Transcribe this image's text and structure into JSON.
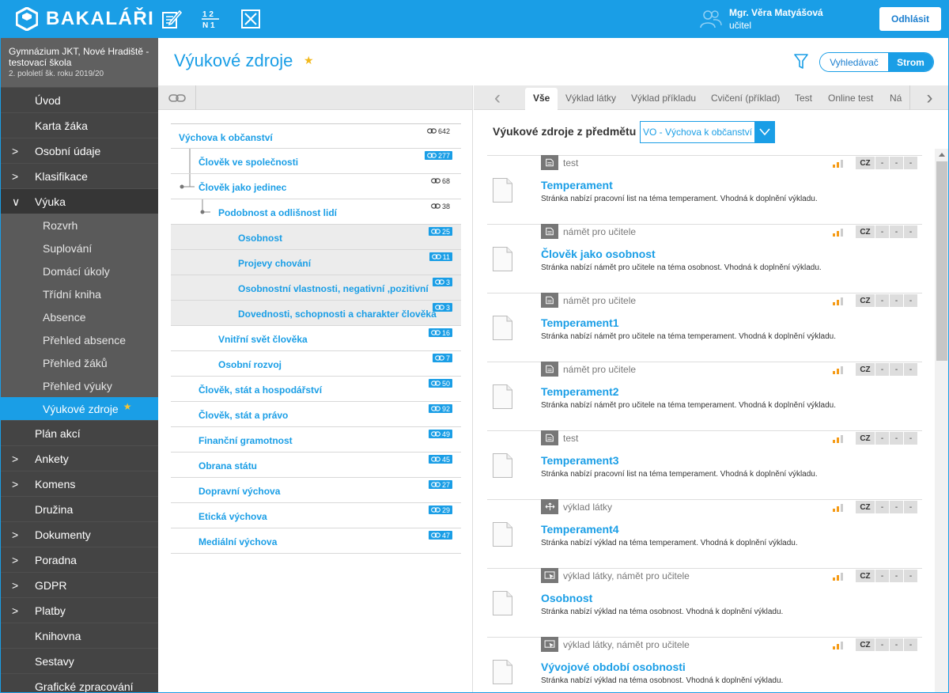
{
  "header": {
    "logo_text": "BAKALÁŘI",
    "user_name": "Mgr. Věra Matyášová",
    "user_role": "učitel",
    "logout_label": "Odhlásit",
    "icons": [
      "edit-note-icon",
      "fraction-icon",
      "close-box-icon",
      "users-icon"
    ]
  },
  "sidebar": {
    "school_name": "Gymnázium JKT, Nové Hradiště - testovací škola",
    "term": "2. pololetí šk. roku 2019/20",
    "items": [
      {
        "label": "Úvod",
        "chevron": ""
      },
      {
        "label": "Karta žáka",
        "chevron": ""
      },
      {
        "label": "Osobní údaje",
        "chevron": ">"
      },
      {
        "label": "Klasifikace",
        "chevron": ">"
      },
      {
        "label": "Výuka",
        "chevron": "∨"
      }
    ],
    "sub_items": [
      {
        "label": "Rozvrh"
      },
      {
        "label": "Suplování"
      },
      {
        "label": "Domácí úkoly"
      },
      {
        "label": "Třídní kniha"
      },
      {
        "label": "Absence"
      },
      {
        "label": "Přehled absence"
      },
      {
        "label": "Přehled žáků"
      },
      {
        "label": "Přehled výuky"
      },
      {
        "label": "Výukové zdroje",
        "active": true
      }
    ],
    "items_after": [
      {
        "label": "Plán akcí",
        "chevron": ""
      },
      {
        "label": "Ankety",
        "chevron": ">"
      },
      {
        "label": "Komens",
        "chevron": ">"
      },
      {
        "label": "Družina",
        "chevron": ""
      },
      {
        "label": "Dokumenty",
        "chevron": ">"
      },
      {
        "label": "Poradna",
        "chevron": ">"
      },
      {
        "label": "GDPR",
        "chevron": ">"
      },
      {
        "label": "Platby",
        "chevron": ">"
      },
      {
        "label": "Knihovna",
        "chevron": ""
      },
      {
        "label": "Sestavy",
        "chevron": ""
      },
      {
        "label": "Grafické zpracování",
        "chevron": ""
      }
    ]
  },
  "page": {
    "title": "Výukové zdroje",
    "favorite_star": "★",
    "view_toggle": {
      "search_label": "Vyhledávač",
      "tree_label": "Strom",
      "selected": "Strom"
    }
  },
  "tree": [
    {
      "label": "Výchova k občanství",
      "count": "642",
      "level": 0,
      "badge_style": "plain"
    },
    {
      "label": "Člověk ve společnosti",
      "count": "277",
      "level": 1,
      "badge_style": "blue"
    },
    {
      "label": "Člověk jako jedinec",
      "count": "68",
      "level": 1,
      "badge_style": "plain"
    },
    {
      "label": "Podobnost a odlišnost lidí",
      "count": "38",
      "level": 2,
      "badge_style": "plain"
    },
    {
      "label": "Osobnost",
      "count": "25",
      "level": 3,
      "badge_style": "blue"
    },
    {
      "label": "Projevy chování",
      "count": "11",
      "level": 3,
      "badge_style": "blue"
    },
    {
      "label": "Osobnostní vlastnosti, negativní ,pozitivní",
      "count": "3",
      "level": 3,
      "badge_style": "blue"
    },
    {
      "label": "Dovednosti, schopnosti a charakter člověka",
      "count": "3",
      "level": 3,
      "badge_style": "blue"
    },
    {
      "label": "Vnitřní svět člověka",
      "count": "16",
      "level": 2,
      "badge_style": "blue"
    },
    {
      "label": "Osobní rozvoj",
      "count": "7",
      "level": 2,
      "badge_style": "blue"
    },
    {
      "label": "Člověk, stát a hospodářství",
      "count": "50",
      "level": 1,
      "badge_style": "blue"
    },
    {
      "label": "Člověk, stát a právo",
      "count": "92",
      "level": 1,
      "badge_style": "blue"
    },
    {
      "label": "Finanční gramotnost",
      "count": "49",
      "level": 1,
      "badge_style": "blue"
    },
    {
      "label": "Obrana státu",
      "count": "45",
      "level": 1,
      "badge_style": "blue"
    },
    {
      "label": "Dopravní výchova",
      "count": "27",
      "level": 1,
      "badge_style": "blue"
    },
    {
      "label": "Etická výchova",
      "count": "29",
      "level": 1,
      "badge_style": "blue"
    },
    {
      "label": "Mediální výchova",
      "count": "47",
      "level": 1,
      "badge_style": "blue"
    }
  ],
  "tabs": [
    "Vše",
    "Výklad látky",
    "Výklad příkladu",
    "Cvičení (příklad)",
    "Test",
    "Online test",
    "Ná"
  ],
  "active_tab": "Vše",
  "subject": {
    "label": "Výukové zdroje z předmětu",
    "selected": "VO - Výchova k občanství"
  },
  "resources": [
    {
      "type": "test",
      "icon": "document-icon",
      "title": "Temperament",
      "desc": "Stránka nabízí pracovní list na téma temperament. Vhodná k doplnění výkladu.",
      "lang": "CZ",
      "slots": [
        "-",
        "-",
        "-"
      ]
    },
    {
      "type": "námět pro učitele",
      "icon": "document-icon",
      "title": "Člověk jako osobnost",
      "desc": "Stránka nabízí námět pro učitele na téma osobnost. Vhodná k doplnění výkladu.",
      "lang": "CZ",
      "slots": [
        "-",
        "-",
        "-"
      ]
    },
    {
      "type": "námět pro učitele",
      "icon": "document-icon",
      "title": "Temperament1",
      "desc": "Stránka nabízí námět pro učitele na téma temperament. Vhodná k doplnění výkladu.",
      "lang": "CZ",
      "slots": [
        "-",
        "-",
        "-"
      ]
    },
    {
      "type": "námět pro učitele",
      "icon": "document-icon",
      "title": "Temperament2",
      "desc": "Stránka nabízí námět pro učitele na téma temperament. Vhodná k doplnění výkladu.",
      "lang": "CZ",
      "slots": [
        "-",
        "-",
        "-"
      ]
    },
    {
      "type": "test",
      "icon": "document-icon",
      "title": "Temperament3",
      "desc": "Stránka nabízí pracovní list na téma temperament. Vhodná k doplnění výkladu.",
      "lang": "CZ",
      "slots": [
        "-",
        "-",
        "-"
      ]
    },
    {
      "type": "výklad látky",
      "icon": "arrows-icon",
      "title": "Temperament4",
      "desc": "Stránka nabízí výklad na téma temperament. Vhodná k doplnění výkladu.",
      "lang": "CZ",
      "slots": [
        "-",
        "-",
        "-"
      ]
    },
    {
      "type": "výklad látky, námět pro učitele",
      "icon": "pointer-screen-icon",
      "title": "Osobnost",
      "desc": "Stránka nabízí výklad na téma osobnost. Vhodná k doplnění výkladu.",
      "lang": "CZ",
      "slots": [
        "-",
        "-",
        "-"
      ]
    },
    {
      "type": "výklad látky, námět pro učitele",
      "icon": "pointer-screen-icon",
      "title": "Vývojové období osobnosti",
      "desc": "Stránka nabízí výklad na téma osobnost. Vhodná k doplnění výkladu.",
      "lang": "CZ",
      "slots": [
        "-",
        "-",
        "-"
      ]
    }
  ],
  "colors": {
    "accent": "#1a9ee6",
    "sidebar": "#444444",
    "level_bar": "#f59b16",
    "star": "#f2b81b"
  }
}
